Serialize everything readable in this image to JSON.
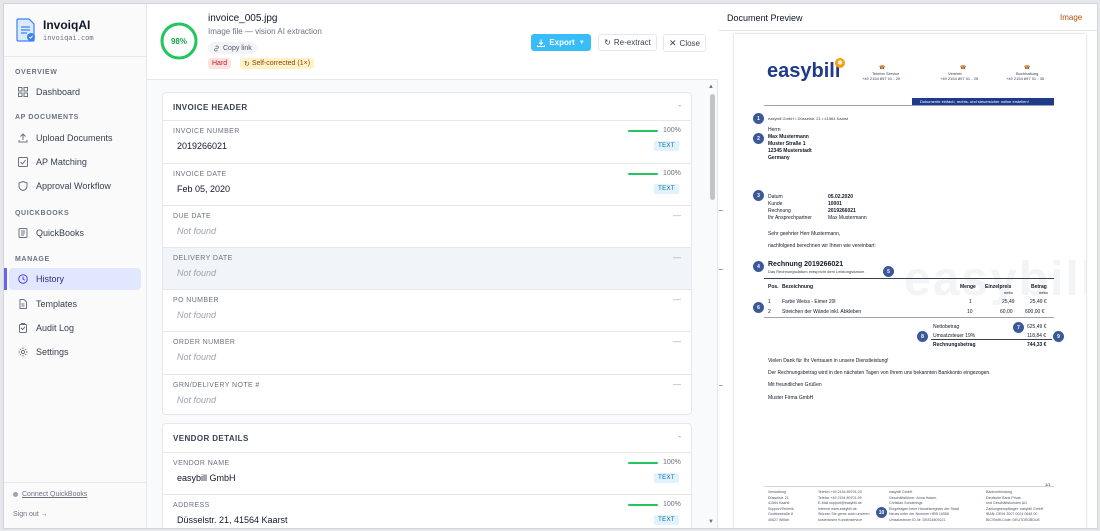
{
  "brand": {
    "name": "InvoiqAI",
    "domain": "invoiqai.com"
  },
  "sidebar": {
    "sections": [
      {
        "label": "OVERVIEW",
        "items": [
          {
            "label": "Dashboard",
            "icon": "grid-icon"
          }
        ]
      },
      {
        "label": "AP DOCUMENTS",
        "items": [
          {
            "label": "Upload Documents",
            "icon": "upload-icon"
          },
          {
            "label": "AP Matching",
            "icon": "check-square-icon"
          },
          {
            "label": "Approval Workflow",
            "icon": "shield-icon"
          }
        ]
      },
      {
        "label": "QUICKBOOKS",
        "items": [
          {
            "label": "QuickBooks",
            "icon": "book-icon"
          }
        ]
      },
      {
        "label": "MANAGE",
        "items": [
          {
            "label": "History",
            "icon": "clock-icon",
            "active": true
          },
          {
            "label": "Templates",
            "icon": "file-icon"
          },
          {
            "label": "Audit Log",
            "icon": "clipboard-icon"
          },
          {
            "label": "Settings",
            "icon": "gear-icon"
          }
        ]
      }
    ],
    "connect_label": "Connect QuickBooks",
    "signout_label": "Sign out →"
  },
  "header": {
    "confidence_label": "98%",
    "confidence_value": 0.98,
    "filename": "invoice_005.jpg",
    "subtitle": "Image file — vision AI extraction",
    "copy_link": "Copy link",
    "difficulty": "Hard",
    "self_corrected": "Self-corrected (1×)",
    "export_label": "Export",
    "reextract_label": "Re-extract",
    "close_label": "Close"
  },
  "colors": {
    "accent": "#38bdf8",
    "success": "#22c55e",
    "active_nav": "#e0e7ff",
    "danger": "#b91c1c"
  },
  "invoice_header": {
    "title": "INVOICE HEADER",
    "collapse": "-",
    "fields": [
      {
        "label": "INVOICE NUMBER",
        "value": "2019266021",
        "confidence": "100%",
        "type": "TEXT"
      },
      {
        "label": "INVOICE DATE",
        "value": "Feb 05, 2020",
        "confidence": "100%",
        "type": "TEXT"
      },
      {
        "label": "DUE DATE",
        "value": "Not found",
        "dash": "—"
      },
      {
        "label": "DELIVERY DATE",
        "value": "Not found",
        "dash": "—"
      },
      {
        "label": "PO NUMBER",
        "value": "Not found",
        "dash": "—"
      },
      {
        "label": "ORDER NUMBER",
        "value": "Not found",
        "dash": "—"
      },
      {
        "label": "GRN/DELIVERY NOTE #",
        "value": "Not found",
        "dash": "—"
      }
    ]
  },
  "vendor_details": {
    "title": "VENDOR DETAILS",
    "collapse": "-",
    "fields": [
      {
        "label": "VENDOR NAME",
        "value": "easybill GmbH",
        "confidence": "100%",
        "type": "TEXT"
      },
      {
        "label": "ADDRESS",
        "value": "Düsselstr. 21, 41564 Kaarst",
        "confidence": "100%",
        "type": "TEXT"
      }
    ]
  },
  "preview": {
    "title": "Document Preview",
    "kind": "Image",
    "doc": {
      "logo": "easybill",
      "tagline": "Dokumente einfach, rechts- und steuersicher online erstellen!",
      "contacts": [
        {
          "label": "Telefon Service",
          "value": "+49 2154 897 01 - 20"
        },
        {
          "label": "Vertrieb",
          "value": "+49 2154 897 01 - 25"
        },
        {
          "label": "Buchhaltung",
          "value": "+49 2154 897 01 - 30"
        }
      ],
      "sender_line": "easybill GmbH • Düsselstr. 21 • 41564 Kaarst",
      "recipient": [
        "Herrn",
        "Max Mustermann",
        "Muster Straße 1",
        "12345 Musterstadt",
        "Germany"
      ],
      "meta": [
        {
          "k": "Datum",
          "v": "05.02.2020"
        },
        {
          "k": "Kunde",
          "v": "10001"
        },
        {
          "k": "Rechnung",
          "v": "2019266021"
        },
        {
          "k": "Ihr Ansprechpartner",
          "v": "Max Mustermann"
        }
      ],
      "greeting": "Sehr geehrter Herr Mustermann,",
      "intro": "nachfolgend berechnen wir Ihnen wie vereinbart:",
      "invoice_title": "Rechnung 2019266021",
      "invoice_sub": "Das Rechnungsdatum entspricht dem Leistungsdatum",
      "table_head": [
        "Pos.",
        "Bezeichnung",
        "Menge",
        "Einzelpreis",
        "Betrag"
      ],
      "table_sub": [
        "netto",
        "netto"
      ],
      "rows": [
        [
          "1",
          "Farbe Weiss - Eimer 20l",
          "1",
          "25,49",
          "25,49 €"
        ],
        [
          "2",
          "Streichen der Wände inkl. Abkleben",
          "10",
          "60,00",
          "600,00 €"
        ]
      ],
      "totals": [
        {
          "k": "Nettobetrag",
          "v": "625,49 €"
        },
        {
          "k": "Umsatzsteuer 19%",
          "v": "118,84 €"
        },
        {
          "k": "Rechnungsbetrag",
          "v": "744,33 €"
        }
      ],
      "closing": [
        "Vielen Dank für Ihr Vertrauen in unsere Dienstleistung!",
        "Der Rechnungsbetrag wird in den nächsten Tagen von Ihrem uns bekannten Bankkonto eingezogen.",
        "Mit freundlichen Grüßen",
        "Muster Firma GmbH"
      ],
      "page": "1/1",
      "footer": [
        [
          "Verwaltung",
          "Düsselstr. 21",
          "41564 Kaarst",
          "Support/Technik",
          "Gruttkestraße 8",
          "40627 Willich"
        ],
        [
          "Telefon  +49 2154 89701-20",
          "Telefax  +49 2154 89701-99",
          "E-Mail   support@easybill.de",
          "Internet  www.easybill.de",
          "Stürzen Sie gerne auch unseren",
          "kostenlosen Kundenservice"
        ],
        [
          "easybill GmbH",
          "Geschäftsführer: Anna Hasen,",
          "Christian Sonderings",
          "Eingetragen beim Handelsregister der Stadt",
          "Neuss unter der Nummer HRB 16558",
          "Umsatzsteuer ID-Nr. DE814809221"
        ],
        [
          "Bankverbindung",
          "Deutsche Bank Privat-",
          "und Geschäftskunden AG",
          "Zahlungsempfänger: easybill GmbH",
          "IBAN: DE94 3007 0024 0648 00",
          "BIC/Swift-Code: DEUTDEDBDUE"
        ]
      ],
      "markers": [
        "1",
        "2",
        "3",
        "4",
        "5",
        "6",
        "7",
        "8",
        "9",
        "10"
      ]
    }
  }
}
